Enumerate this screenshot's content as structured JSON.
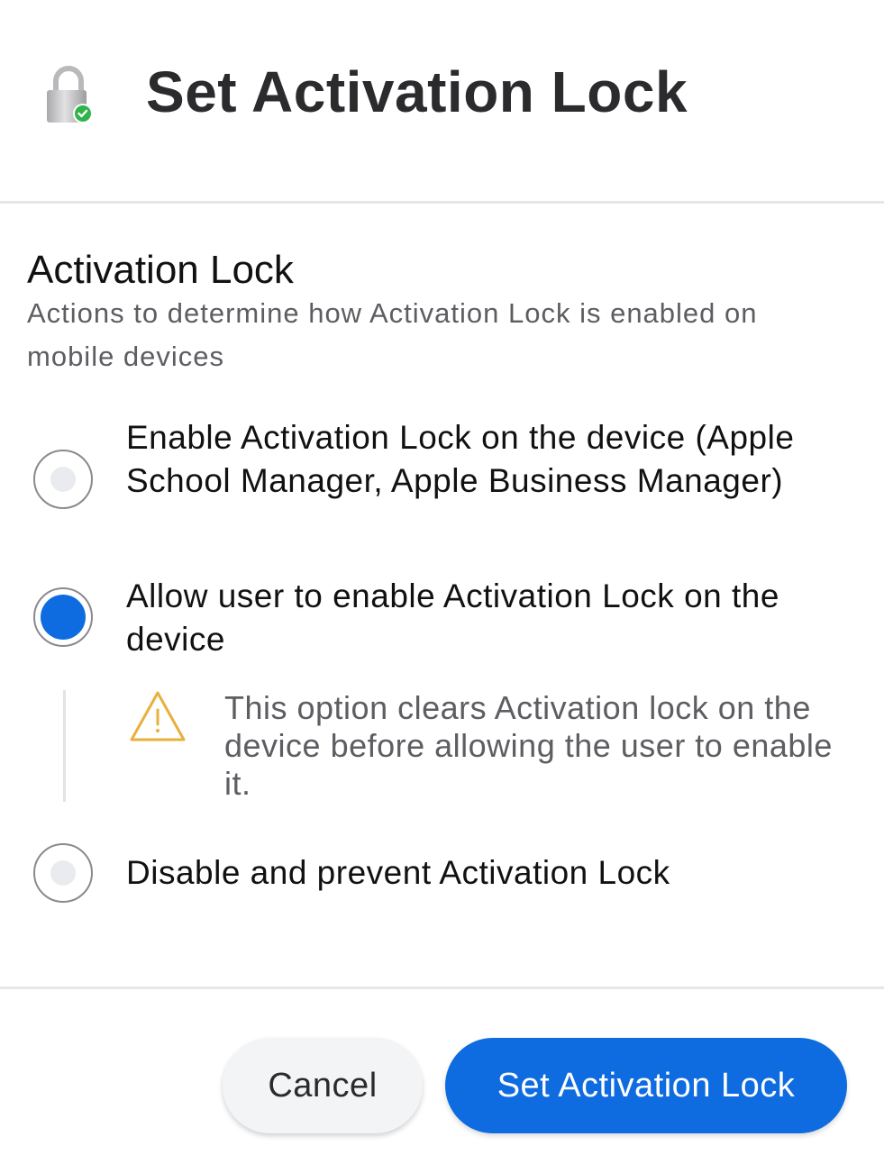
{
  "header": {
    "title": "Set Activation Lock",
    "icon": "lock-check-icon"
  },
  "section": {
    "title": "Activation Lock",
    "description": "Actions to determine how Activation Lock is enabled on mobile devices"
  },
  "options": [
    {
      "label": "Enable Activation Lock on the device (Apple School Manager, Apple Business Manager)",
      "selected": false
    },
    {
      "label": "Allow user to enable Activation Lock on the device",
      "selected": true
    },
    {
      "label": "Disable and prevent Activation Lock",
      "selected": false
    }
  ],
  "note": {
    "icon": "warning-icon",
    "text": "This option clears Activation lock on the device before allowing the user to enable it."
  },
  "footer": {
    "cancel_label": "Cancel",
    "submit_label": "Set Activation Lock"
  },
  "colors": {
    "accent": "#0f6ce0",
    "warning": "#e8b03c",
    "success": "#2fb34a"
  }
}
